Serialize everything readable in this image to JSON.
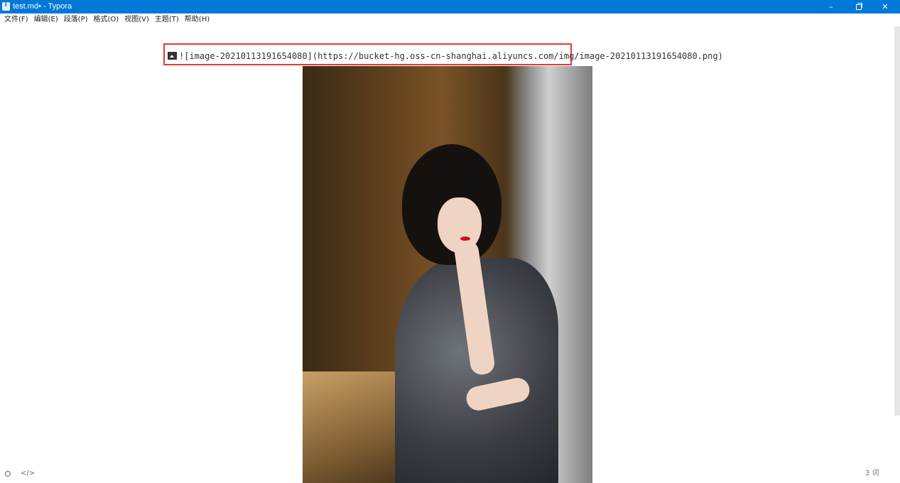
{
  "window": {
    "title": "test.md• - Typora",
    "minimize_glyph": "–",
    "close_glyph": "✕"
  },
  "menu": {
    "items": [
      "文件(F)",
      "编辑(E)",
      "段落(P)",
      "格式(O)",
      "视图(V)",
      "主题(T)",
      "帮助(H)"
    ]
  },
  "editor": {
    "markdown_source": "![image-20210113191654080](https://bucket-hg.oss-cn-shanghai.aliyuncs.com/img/image-20210113191654080.png)"
  },
  "status": {
    "source_toggle_glyph": "</>",
    "word_count": "3 词"
  },
  "colors": {
    "titlebar": "#0078d7",
    "highlight": "#e53935"
  },
  "icons": {
    "app": "typora-icon",
    "image": "image-icon",
    "outline": "circle-icon",
    "source": "code-icon"
  }
}
